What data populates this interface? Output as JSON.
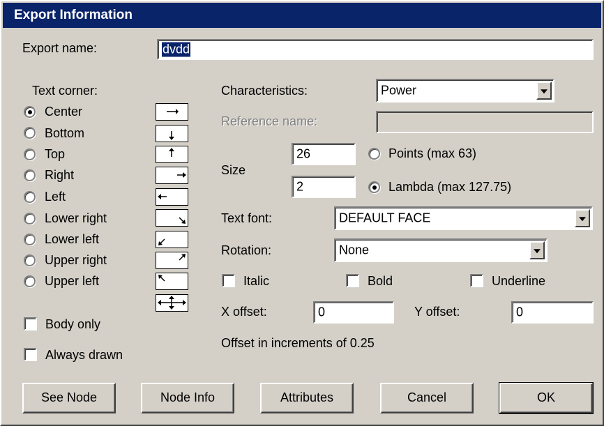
{
  "window": {
    "title": "Export Information"
  },
  "export_name": {
    "label": "Export name:",
    "value": "dvdd"
  },
  "text_corner": {
    "label": "Text corner:",
    "options": [
      "Center",
      "Bottom",
      "Top",
      "Right",
      "Left",
      "Lower right",
      "Lower left",
      "Upper right",
      "Upper left"
    ],
    "selected": "Center"
  },
  "body_only": {
    "label": "Body only",
    "checked": false
  },
  "always_drawn": {
    "label": "Always drawn",
    "checked": false
  },
  "characteristics": {
    "label": "Characteristics:",
    "value": "Power"
  },
  "reference_name": {
    "label": "Reference name:",
    "value": ""
  },
  "size": {
    "label": "Size",
    "points_value": "26",
    "lambda_value": "2",
    "points_label": "Points (max 63)",
    "lambda_label": "Lambda (max 127.75)",
    "selected": "lambda"
  },
  "text_font": {
    "label": "Text font:",
    "value": "DEFAULT FACE"
  },
  "rotation": {
    "label": "Rotation:",
    "value": "None"
  },
  "style": {
    "italic": "Italic",
    "bold": "Bold",
    "underline": "Underline"
  },
  "x_offset": {
    "label": "X offset:",
    "value": "0"
  },
  "y_offset": {
    "label": "Y offset:",
    "value": "0"
  },
  "offset_note": "Offset in increments of 0.25",
  "buttons": {
    "see_node": "See Node",
    "node_info": "Node Info",
    "attributes": "Attributes",
    "cancel": "Cancel",
    "ok": "OK"
  },
  "colors": {
    "title_bar": "#0a246a",
    "face": "#d4d0c8",
    "disabled_text": "#808080"
  }
}
